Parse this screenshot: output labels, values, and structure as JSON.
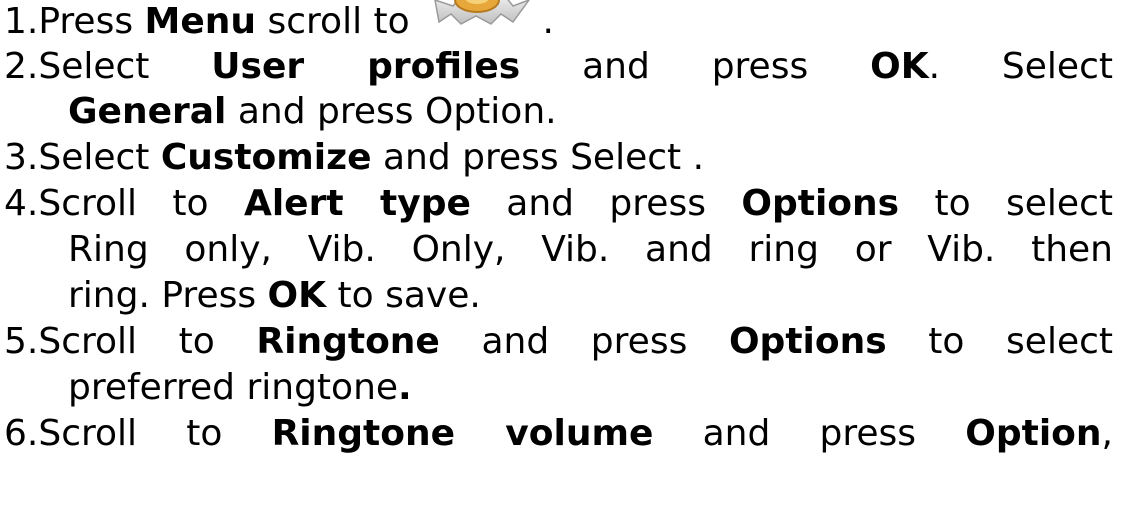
{
  "steps": [
    {
      "lines": [
        [
          {
            "t": "1.Press "
          },
          {
            "t": "Menu",
            "b": true
          },
          {
            "t": " scroll to "
          },
          {
            "icon": "gear-icon"
          },
          {
            "t": " ."
          }
        ]
      ]
    },
    {
      "lines": [
        [
          {
            "t": "2.Select "
          },
          {
            "t": "User profiles",
            "b": true
          },
          {
            "t": " and press "
          },
          {
            "t": "OK",
            "b": true
          },
          {
            "t": ". Select"
          }
        ],
        [
          {
            "t": "General",
            "b": true
          },
          {
            "t": " and press Option."
          }
        ]
      ]
    },
    {
      "lines": [
        [
          {
            "t": "3.Select "
          },
          {
            "t": "Customize",
            "b": true
          },
          {
            "t": " and press Select ."
          }
        ]
      ]
    },
    {
      "lines": [
        [
          {
            "t": "4.Scroll to "
          },
          {
            "t": "Alert type",
            "b": true
          },
          {
            "t": " and press "
          },
          {
            "t": "Options",
            "b": true
          },
          {
            "t": " to select"
          }
        ],
        [
          {
            "t": "Ring only, Vib. Only, Vib. and ring or Vib. then"
          }
        ],
        [
          {
            "t": "ring. Press "
          },
          {
            "t": "OK",
            "b": true
          },
          {
            "t": " to save."
          }
        ]
      ]
    },
    {
      "lines": [
        [
          {
            "t": "5.Scroll to "
          },
          {
            "t": "Ringtone",
            "b": true
          },
          {
            "t": " and press "
          },
          {
            "t": "Options",
            "b": true
          },
          {
            "t": " to select"
          }
        ],
        [
          {
            "t": "preferred ringtone"
          },
          {
            "t": ".",
            "b": true
          }
        ]
      ]
    },
    {
      "lines": [
        [
          {
            "t": "6.Scroll to "
          },
          {
            "t": "Ringtone volume",
            "b": true
          },
          {
            "t": " and press "
          },
          {
            "t": "Option",
            "b": true
          },
          {
            "t": ","
          }
        ]
      ]
    }
  ]
}
